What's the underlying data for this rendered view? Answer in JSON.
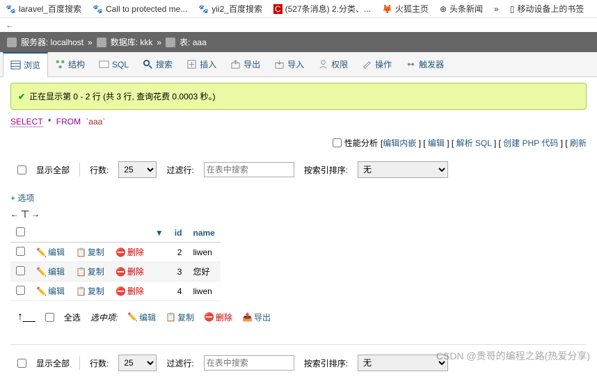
{
  "bookmarks": {
    "items": [
      "laravel_百度搜索",
      "Call to protected me...",
      "yii2_百度搜索",
      "(527条消息) 2.分类、...",
      "火狐主页",
      "头条新闻",
      "移动设备上的书签"
    ],
    "nav": "←"
  },
  "crumb": {
    "server_label": "服务器: localhost",
    "db_label": "数据库: kkk",
    "table_label": "表: aaa",
    "sep": "»"
  },
  "tabs": [
    {
      "label": "浏览"
    },
    {
      "label": "结构"
    },
    {
      "label": "SQL"
    },
    {
      "label": "搜索"
    },
    {
      "label": "插入"
    },
    {
      "label": "导出"
    },
    {
      "label": "导入"
    },
    {
      "label": "权限"
    },
    {
      "label": "操作"
    },
    {
      "label": "触发器"
    }
  ],
  "msg": {
    "text": "正在显示第 0 - 2 行 (共 3 行, 查询花费 0.0003 秒。)"
  },
  "sql": {
    "select": "SELECT",
    "star": "*",
    "from": "FROM",
    "table": "`aaa`"
  },
  "profile": {
    "label": "性能分析",
    "links": [
      "编辑内嵌",
      "编辑",
      "解析 SQL",
      "创建 PHP 代码",
      "刷新"
    ]
  },
  "ctrl": {
    "showall": "显示全部",
    "rows": "行数:",
    "rows_val": "25",
    "filter": "过滤行:",
    "filter_ph": "在表中搜索",
    "sort": "按索引排序:",
    "sort_val": "无"
  },
  "opt": {
    "plus": "+ 选项",
    "arrows": "←丅→"
  },
  "thead": {
    "sort": "▼",
    "id": "id",
    "name": "name"
  },
  "rows": [
    {
      "id": "2",
      "name": "liwen"
    },
    {
      "id": "3",
      "name": "您好"
    },
    {
      "id": "4",
      "name": "liwen"
    }
  ],
  "row_actions": {
    "edit": "编辑",
    "copy": "复制",
    "delete": "删除"
  },
  "bulk": {
    "arrow": "↑__",
    "selectall": "全选",
    "selected": "选中项:",
    "edit": "编辑",
    "copy": "复制",
    "delete": "删除",
    "export": "导出"
  },
  "watermark": "CSDN @贵哥的编程之路(热爱分享)"
}
